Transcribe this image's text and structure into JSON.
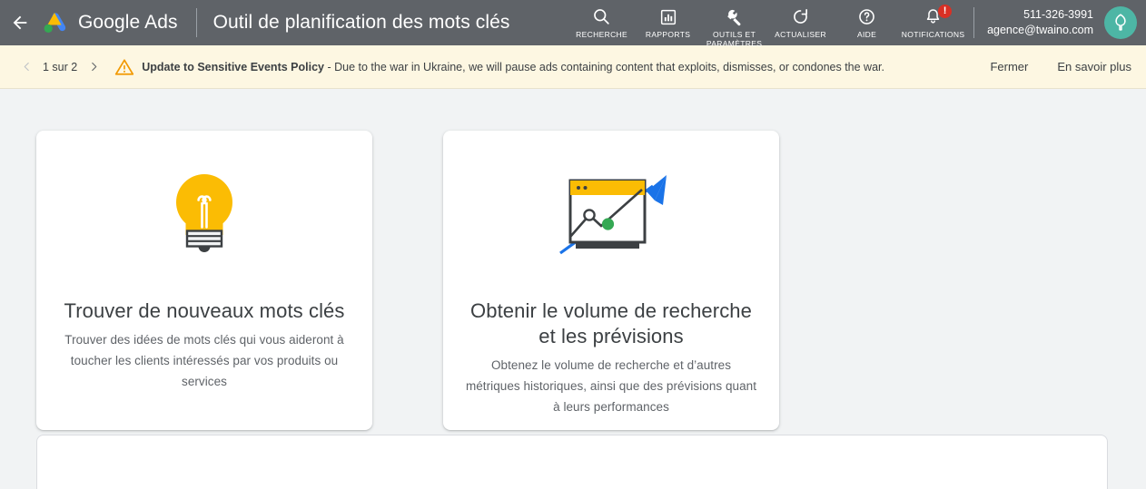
{
  "header": {
    "back_icon": "arrow-left-icon",
    "brand": "Google Ads",
    "page_title": "Outil de planification des mots clés",
    "tools": [
      {
        "icon": "search-icon",
        "label": "RECHERCHE",
        "badge": null
      },
      {
        "icon": "reports-icon",
        "label": "RAPPORTS",
        "badge": null
      },
      {
        "icon": "wrench-icon",
        "label": "OUTILS ET\nPARAMÈTRES",
        "badge": null
      },
      {
        "icon": "refresh-icon",
        "label": "ACTUALISER",
        "badge": null
      },
      {
        "icon": "help-icon",
        "label": "AIDE",
        "badge": null
      },
      {
        "icon": "bell-icon",
        "label": "NOTIFICATIONS",
        "badge": "!"
      }
    ],
    "account_id": "511-326-3991",
    "account_email": "agence@twaino.com",
    "avatar_icon": "leaf-avatar-icon",
    "bar_color": "#5f6368"
  },
  "policy_bar": {
    "prev_icon": "chevron-left-icon",
    "next_icon": "chevron-right-icon",
    "pager_text": "1 sur 2",
    "warning_icon": "warning-triangle-icon",
    "message_bold": "Update to Sensitive Events Policy",
    "message_rest": " - Due to the war in Ukraine, we will pause ads containing content that exploits, dismisses, or condones the war.",
    "close_label": "Fermer",
    "learn_more_label": "En savoir plus",
    "background": "#fdf7e2",
    "warning_color": "#f29900"
  },
  "cards": [
    {
      "art_icon": "lightbulb-icon",
      "title": "Trouver de nouveaux mots clés",
      "description": "Trouver des idées de mots clés qui vous aideront à toucher les clients intéressés par vos produits ou services",
      "accent": "#fbbc04"
    },
    {
      "art_icon": "growth-chart-icon",
      "title": "Obtenir le volume de recherche et les prévisions",
      "description": "Obtenez le volume de recherche et d’autres métriques historiques, ainsi que des prévisions quant à leurs performances",
      "accent": "#1a73e8"
    }
  ],
  "colors": {
    "page_background": "#f1f3f4",
    "card_background": "#ffffff",
    "text_primary": "#3c4043",
    "text_secondary": "#5f6368"
  }
}
